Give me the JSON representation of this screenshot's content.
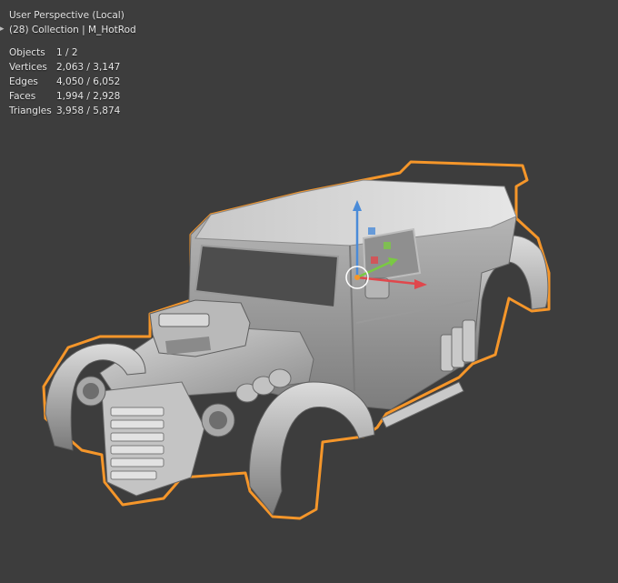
{
  "viewport": {
    "view_name": "User Perspective (Local)",
    "collection_line": "(28) Collection | M_HotRod",
    "stats": [
      {
        "label": "Objects",
        "value": "1 / 2"
      },
      {
        "label": "Vertices",
        "value": "2,063 / 3,147"
      },
      {
        "label": "Edges",
        "value": "4,050 / 6,052"
      },
      {
        "label": "Faces",
        "value": "1,994 / 2,928"
      },
      {
        "label": "Triangles",
        "value": "3,958 / 5,874"
      }
    ]
  },
  "colors": {
    "background": "#3d3d3d",
    "selection_outline": "#f5962a",
    "gizmo_x": "#e0474c",
    "gizmo_y": "#7ac943",
    "gizmo_z": "#4a8bd8"
  },
  "icons": {
    "sidebar_toggle": "chevron-right-icon",
    "transform_gizmo": "move-gizmo-icon"
  }
}
